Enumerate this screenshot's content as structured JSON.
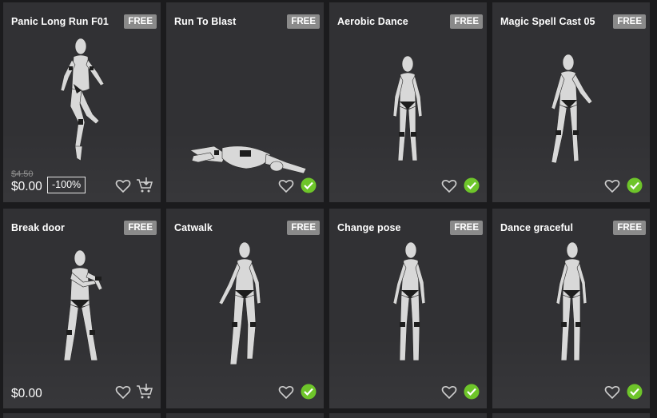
{
  "cards": [
    {
      "title": "Panic Long Run F01",
      "badge": "FREE",
      "old_price": "$4.50",
      "price": "$0.00",
      "discount": "-100%"
    },
    {
      "title": "Run To Blast",
      "badge": "FREE"
    },
    {
      "title": "Aerobic Dance",
      "badge": "FREE"
    },
    {
      "title": "Magic Spell Cast 05",
      "badge": "FREE"
    },
    {
      "title": "Break door",
      "badge": "FREE",
      "price": "$0.00"
    },
    {
      "title": "Catwalk",
      "badge": "FREE"
    },
    {
      "title": "Change pose",
      "badge": "FREE"
    },
    {
      "title": "Dance graceful",
      "badge": "FREE"
    }
  ],
  "colors": {
    "card_bg": "#313134",
    "page_bg": "#1b1b1d",
    "badge_bg": "#8a8a8a",
    "owned_check": "#6ec52a"
  },
  "icons": {
    "wishlist": "heart-icon",
    "add_to_cart": "cart-add-icon",
    "owned": "check-circle-icon"
  }
}
